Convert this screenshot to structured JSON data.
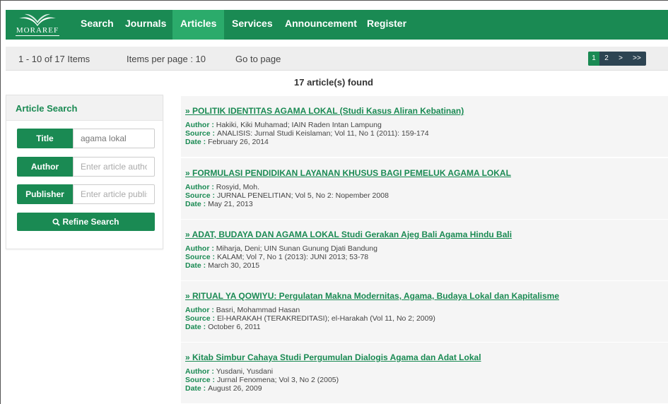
{
  "nav": {
    "logo_text": "MORAREF",
    "items": [
      "Search",
      "Journals",
      "Articles",
      "Services",
      "Announcement",
      "Register"
    ],
    "active": "Articles",
    "color": "#1a8a53"
  },
  "pager": {
    "range": "1 - 10 of 17 Items",
    "per_page": "Items per page : 10",
    "goto": "Go to page",
    "pages": [
      "1",
      "2",
      ">",
      ">>"
    ]
  },
  "found": {
    "count": "17",
    "suffix": " article(s) found"
  },
  "sidebar": {
    "heading": "Article Search",
    "fields": [
      {
        "label": "Title",
        "value": "agama lokal",
        "placeholder": ""
      },
      {
        "label": "Author",
        "value": "",
        "placeholder": "Enter article author"
      },
      {
        "label": "Publisher",
        "value": "",
        "placeholder": "Enter article publisher"
      }
    ],
    "refine_label": "Refine Search"
  },
  "labels": {
    "author": "Author : ",
    "source": "Source : ",
    "date": "Date : "
  },
  "results": [
    {
      "title": "» POLITIK IDENTITAS AGAMA LOKAL (Studi Kasus Aliran Kebatinan)",
      "author": "Hakiki, Kiki Muhamad; IAIN Raden Intan Lampung",
      "source": "ANALISIS: Jurnal Studi Keislaman; Vol 11, No 1 (2011): 159-174",
      "date": "February 26, 2014"
    },
    {
      "title": "» FORMULASI PENDIDIKAN LAYANAN KHUSUS BAGI PEMELUK AGAMA LOKAL",
      "author": "Rosyid, Moh.",
      "source": "JURNAL PENELITIAN; Vol 5, No 2: Nopember 2008",
      "date": "May 21, 2013"
    },
    {
      "title": "» ADAT, BUDAYA DAN AGAMA LOKAL Studi Gerakan Ajeg Bali Agama Hindu Bali",
      "author": "Miharja, Deni; UIN Sunan Gunung Djati Bandung",
      "source": "KALAM; Vol 7, No 1 (2013): JUNI 2013; 53-78",
      "date": "March 30, 2015"
    },
    {
      "title": "» RITUAL YA QOWIYU: Pergulatan Makna Modernitas, Agama, Budaya Lokal dan Kapitalisme",
      "author": "Basri, Mohammad Hasan",
      "source": "El-HARAKAH (TERAKREDITASI); el-Harakah (Vol 11, No 2; 2009)",
      "date": "October 6, 2011"
    },
    {
      "title": "» Kitab Simbur Cahaya Studi Pergumulan Dialogis Agama dan Adat Lokal",
      "author": "Yusdani, Yusdani",
      "source": "Jurnal Fenomena; Vol 3, No 2 (2005)",
      "date": "August 26, 2009"
    }
  ]
}
